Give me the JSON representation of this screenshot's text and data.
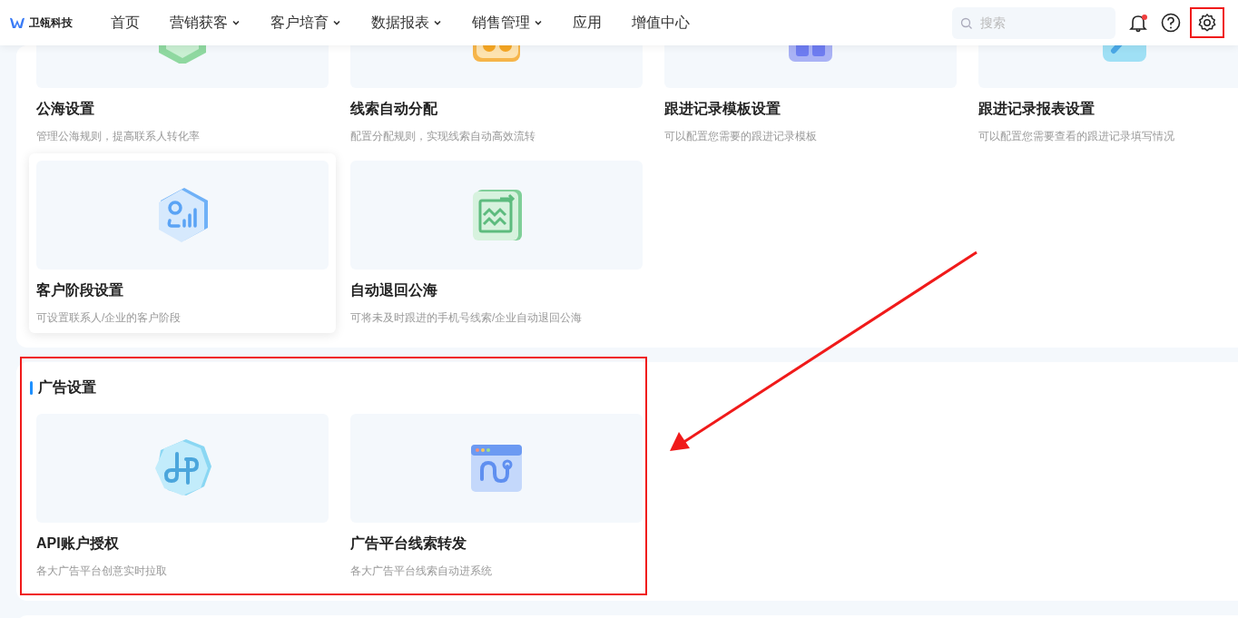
{
  "nav": {
    "logo_text": "卫瓴科技",
    "menu": [
      {
        "label": "首页",
        "dropdown": false
      },
      {
        "label": "营销获客",
        "dropdown": true
      },
      {
        "label": "客户培育",
        "dropdown": true
      },
      {
        "label": "数据报表",
        "dropdown": true
      },
      {
        "label": "销售管理",
        "dropdown": true
      },
      {
        "label": "应用",
        "dropdown": false
      },
      {
        "label": "增值中心",
        "dropdown": false
      }
    ],
    "search": {
      "placeholder": "搜索"
    },
    "has_unread": true,
    "settings_highlighted": true
  },
  "sections": [
    {
      "highlighted": false,
      "cards": [
        {
          "title": "公海设置",
          "description": "管理公海规则，提高联系人转化率",
          "hovered": false
        },
        {
          "title": "线索自动分配",
          "description": "配置分配规则，实现线索自动高效流转",
          "hovered": false
        },
        {
          "title": "跟进记录模板设置",
          "description": "可以配置您需要的跟进记录模板",
          "hovered": false
        },
        {
          "title": "跟进记录报表设置",
          "description": "可以配置您需要查看的跟进记录填写情况",
          "hovered": false
        },
        {
          "title": "客户阶段设置",
          "description": "可设置联系人/企业的客户阶段",
          "hovered": true
        },
        {
          "title": "自动退回公海",
          "description": "可将未及时跟进的手机号线索/企业自动退回公海",
          "hovered": false
        }
      ]
    },
    {
      "title": "广告设置",
      "highlighted": true,
      "cards": [
        {
          "title": "API账户授权",
          "description": "各大广告平台创意实时拉取",
          "hovered": false
        },
        {
          "title": "广告平台线索转发",
          "description": "各大广告平台线索自动进系统",
          "hovered": false
        }
      ]
    }
  ]
}
